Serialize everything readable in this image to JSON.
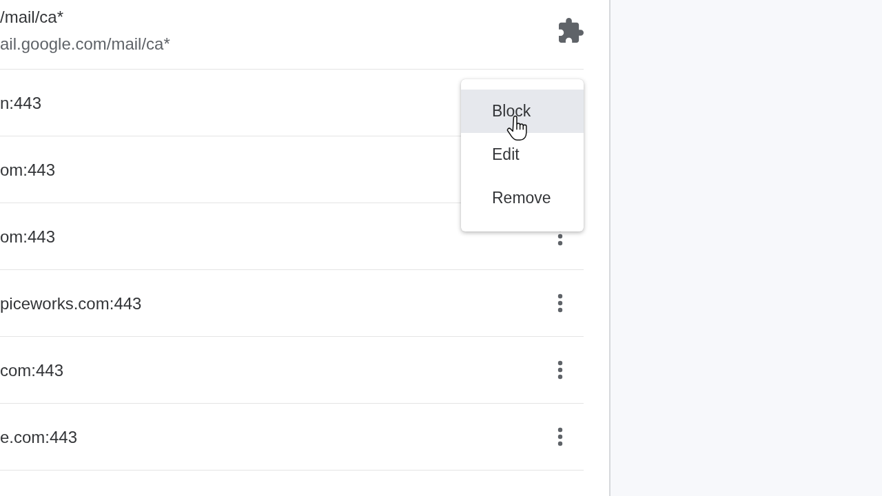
{
  "site_list": {
    "rows": [
      {
        "kind": "extension",
        "site": "/mail/ca*",
        "detail": "ail.google.com/mail/ca*"
      },
      {
        "kind": "plain",
        "site": "n:443"
      },
      {
        "kind": "plain",
        "site": "om:443"
      },
      {
        "kind": "menu",
        "site": "om:443"
      },
      {
        "kind": "menu",
        "site": "piceworks.com:443"
      },
      {
        "kind": "menu",
        "site": "com:443"
      },
      {
        "kind": "menu",
        "site": "e.com:443"
      }
    ]
  },
  "action_menu": {
    "items": [
      {
        "label": "Block",
        "highlighted": true
      },
      {
        "label": "Edit",
        "highlighted": false
      },
      {
        "label": "Remove",
        "highlighted": false
      }
    ]
  }
}
